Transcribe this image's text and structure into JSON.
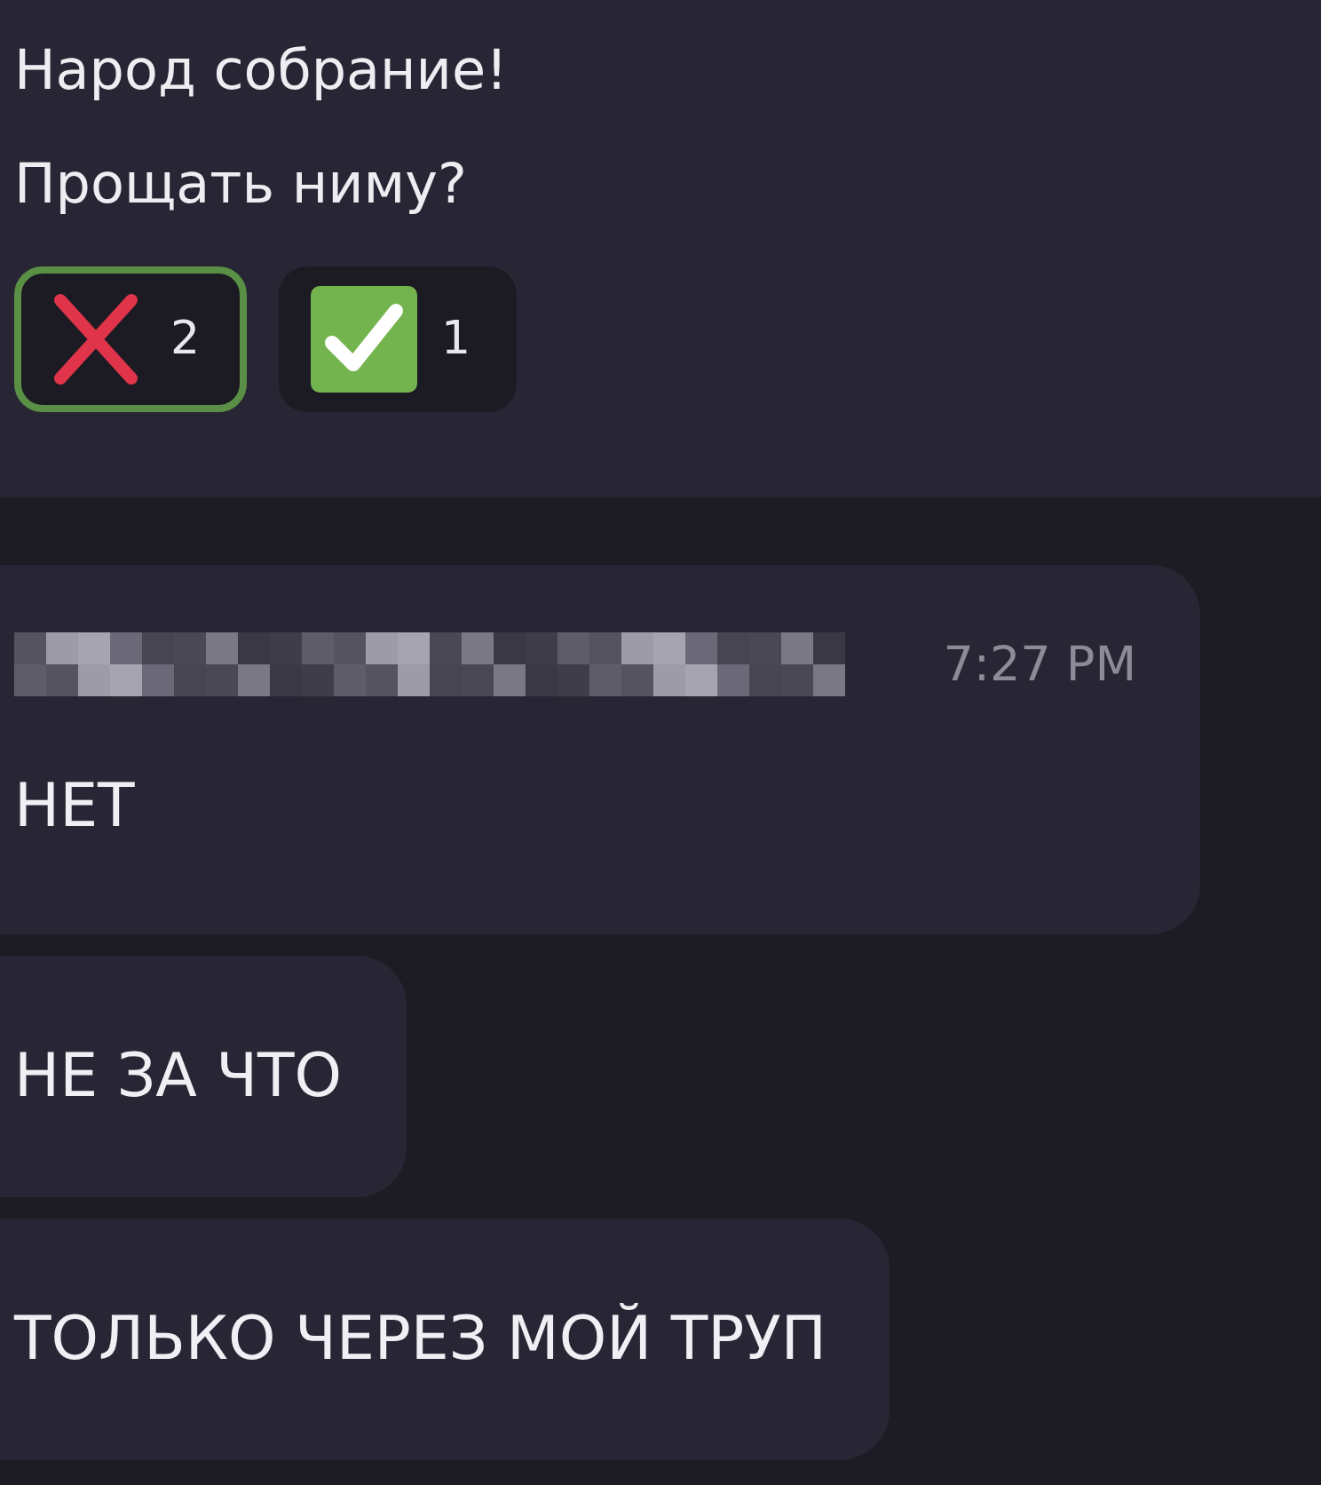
{
  "poll": {
    "lines": [
      "Народ собрание!",
      "Прощать ниму?"
    ],
    "reactions": [
      {
        "kind": "cross",
        "count": "2",
        "selected": true
      },
      {
        "kind": "check",
        "count": "1",
        "selected": false
      }
    ]
  },
  "messages": [
    {
      "time": "7:27 PM",
      "text": "НЕТ"
    },
    {
      "text": "НЕ ЗА ЧТО"
    },
    {
      "text": "ТОЛЬКО ЧЕРЕЗ МОЙ ТРУП"
    }
  ]
}
